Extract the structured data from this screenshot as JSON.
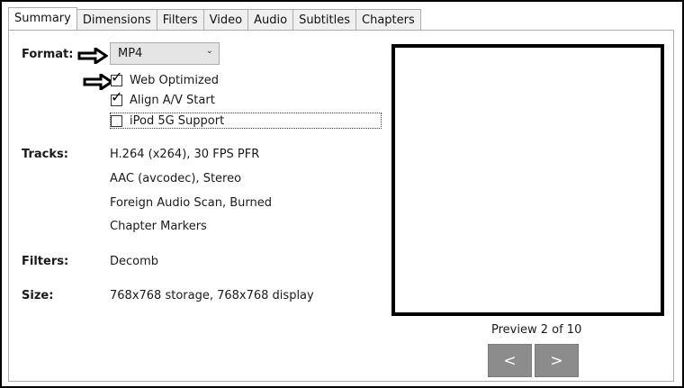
{
  "tabs": [
    "Summary",
    "Dimensions",
    "Filters",
    "Video",
    "Audio",
    "Subtitles",
    "Chapters"
  ],
  "format": {
    "label": "Format:",
    "value": "MP4"
  },
  "options": {
    "web_optimized": {
      "label": "Web Optimized",
      "checked": true
    },
    "align_av": {
      "label": "Align A/V Start",
      "checked": true
    },
    "ipod": {
      "label": "iPod 5G Support",
      "checked": false
    }
  },
  "tracks": {
    "label": "Tracks:",
    "items": [
      "H.264 (x264), 30 FPS PFR",
      "AAC (avcodec), Stereo",
      "Foreign Audio Scan, Burned",
      "Chapter Markers"
    ]
  },
  "filters": {
    "label": "Filters:",
    "value": "Decomb"
  },
  "size": {
    "label": "Size:",
    "value": "768x768 storage, 768x768 display"
  },
  "preview": {
    "caption": "Preview 2 of 10",
    "prev": "<",
    "next": ">"
  },
  "icons": {
    "arrow1": "right-arrow-icon",
    "arrow2": "right-arrow-icon",
    "chevron": "chevron-down-icon"
  }
}
